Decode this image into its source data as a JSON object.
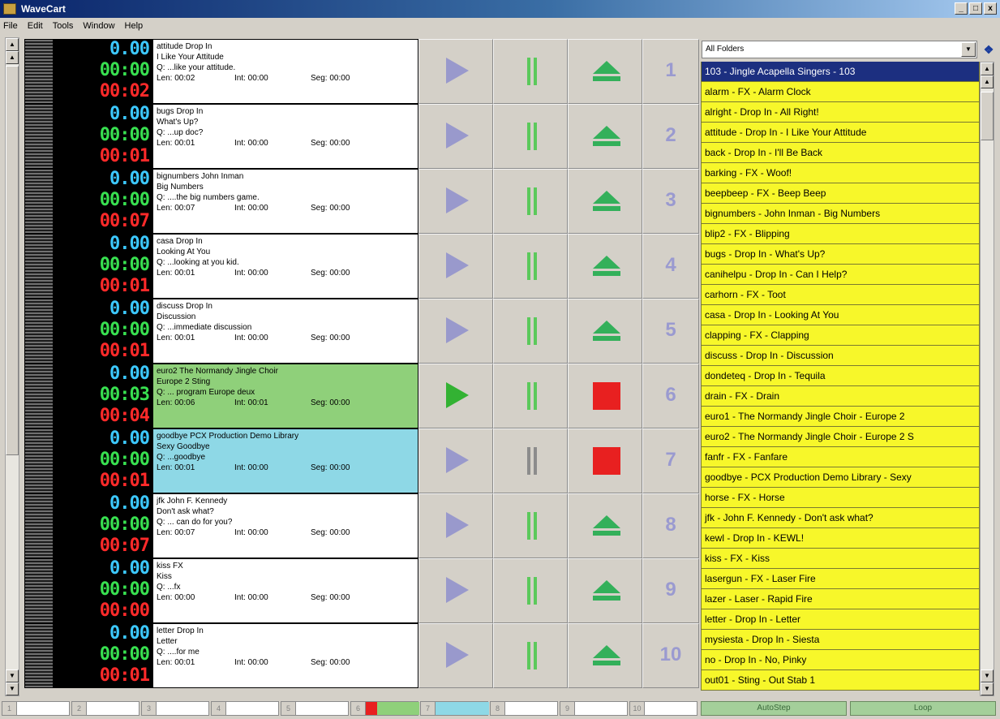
{
  "window": {
    "title": "WaveCart",
    "controls": [
      "_",
      "□",
      "x"
    ]
  },
  "menu": [
    "File",
    "Edit",
    "Tools",
    "Window",
    "Help"
  ],
  "carts": [
    {
      "num": "1",
      "t1": "0.00",
      "t2": "00:00",
      "t3": "00:02",
      "name": "attitude  Drop In",
      "title": "I Like Your Attitude",
      "cue": "Q: ...like your attitude.",
      "len": "Len: 00:02",
      "int": "Int: 00:00",
      "seg": "Seg: 00:00",
      "state": "idle"
    },
    {
      "num": "2",
      "t1": "0.00",
      "t2": "00:00",
      "t3": "00:01",
      "name": "bugs  Drop In",
      "title": "What's Up?",
      "cue": "Q: ...up doc?",
      "len": "Len: 00:01",
      "int": "Int: 00:00",
      "seg": "Seg: 00:00",
      "state": "idle"
    },
    {
      "num": "3",
      "t1": "0.00",
      "t2": "00:00",
      "t3": "00:07",
      "name": "bignumbers  John Inman",
      "title": "Big Numbers",
      "cue": "Q: ....the big numbers game.",
      "len": "Len: 00:07",
      "int": "Int: 00:00",
      "seg": "Seg: 00:00",
      "state": "idle"
    },
    {
      "num": "4",
      "t1": "0.00",
      "t2": "00:00",
      "t3": "00:01",
      "name": "casa  Drop In",
      "title": "Looking At You",
      "cue": "Q: ...looking at you kid.",
      "len": "Len: 00:01",
      "int": "Int: 00:00",
      "seg": "Seg: 00:00",
      "state": "idle"
    },
    {
      "num": "5",
      "t1": "0.00",
      "t2": "00:00",
      "t3": "00:01",
      "name": "discuss  Drop In",
      "title": "Discussion",
      "cue": "Q: ...immediate discussion",
      "len": "Len: 00:01",
      "int": "Int: 00:00",
      "seg": "Seg: 00:00",
      "state": "idle"
    },
    {
      "num": "6",
      "t1": "0.00",
      "t2": "00:03",
      "t3": "00:04",
      "name": "euro2  The Normandy Jingle Choir",
      "title": "Europe 2 Sting",
      "cue": "Q: ... program Europe deux",
      "len": "Len: 00:06",
      "int": "Int: 00:01",
      "seg": "Seg: 00:00",
      "state": "playing"
    },
    {
      "num": "7",
      "t1": "0.00",
      "t2": "00:00",
      "t3": "00:01",
      "name": "goodbye  PCX Production Demo Library",
      "title": "Sexy Goodbye",
      "cue": "Q: ...goodbye",
      "len": "Len: 00:01",
      "int": "Int: 00:00",
      "seg": "Seg: 00:00",
      "state": "paused"
    },
    {
      "num": "8",
      "t1": "0.00",
      "t2": "00:00",
      "t3": "00:07",
      "name": "jfk  John F. Kennedy",
      "title": "Don't ask what?",
      "cue": "Q: ... can do for you?",
      "len": "Len: 00:07",
      "int": "Int: 00:00",
      "seg": "Seg: 00:00",
      "state": "idle"
    },
    {
      "num": "9",
      "t1": "0.00",
      "t2": "00:00",
      "t3": "00:00",
      "name": "kiss  FX",
      "title": "Kiss",
      "cue": "Q: ...fx",
      "len": "Len: 00:00",
      "int": "Int: 00:00",
      "seg": "Seg: 00:00",
      "state": "idle"
    },
    {
      "num": "10",
      "t1": "0.00",
      "t2": "00:00",
      "t3": "00:01",
      "name": "letter  Drop In",
      "title": "Letter",
      "cue": "Q: ....for me",
      "len": "Len: 00:01",
      "int": "Int: 00:00",
      "seg": "Seg: 00:00",
      "state": "idle"
    }
  ],
  "library": {
    "folder": "All Folders",
    "items": [
      "103 - Jingle Acapella Singers - 103",
      "alarm - FX - Alarm Clock",
      "alright - Drop In - All Right!",
      "attitude - Drop In - I Like Your Attitude",
      "back - Drop In - I'll Be Back",
      "barking - FX - Woof!",
      "beepbeep - FX - Beep Beep",
      "bignumbers - John Inman - Big Numbers",
      "blip2 - FX - Blipping",
      "bugs - Drop In - What's Up?",
      "canihelpu - Drop In - Can I Help?",
      "carhorn - FX - Toot",
      "casa - Drop In - Looking At You",
      "clapping - FX - Clapping",
      "discuss - Drop In - Discussion",
      "dondeteq - Drop In - Tequila",
      "drain - FX - Drain",
      "euro1 - The Normandy Jingle Choir - Europe 2",
      "euro2 - The Normandy Jingle Choir - Europe 2 S",
      "fanfr - FX - Fanfare",
      "goodbye - PCX Production Demo Library - Sexy",
      "horse - FX - Horse",
      "jfk - John F. Kennedy - Don't ask what?",
      "kewl - Drop In - KEWL!",
      "kiss - FX - Kiss",
      "lasergun - FX - Laser Fire",
      "lazer - Laser - Rapid Fire",
      "letter - Drop In - Letter",
      "mysiesta - Drop In - Siesta",
      "no - Drop In - No, Pinky",
      "out01 - Sting - Out Stab 1"
    ],
    "selected_index": 0
  },
  "bottom": {
    "slots": [
      "1",
      "2",
      "3",
      "4",
      "5",
      "6",
      "7",
      "8",
      "9",
      "10"
    ],
    "autostep": "AutoStep",
    "loop": "Loop"
  },
  "colors": {
    "playing": "#8fd07a",
    "paused": "#8ed8e6",
    "library_item": "#f7f72a",
    "stop": "#e82020"
  }
}
